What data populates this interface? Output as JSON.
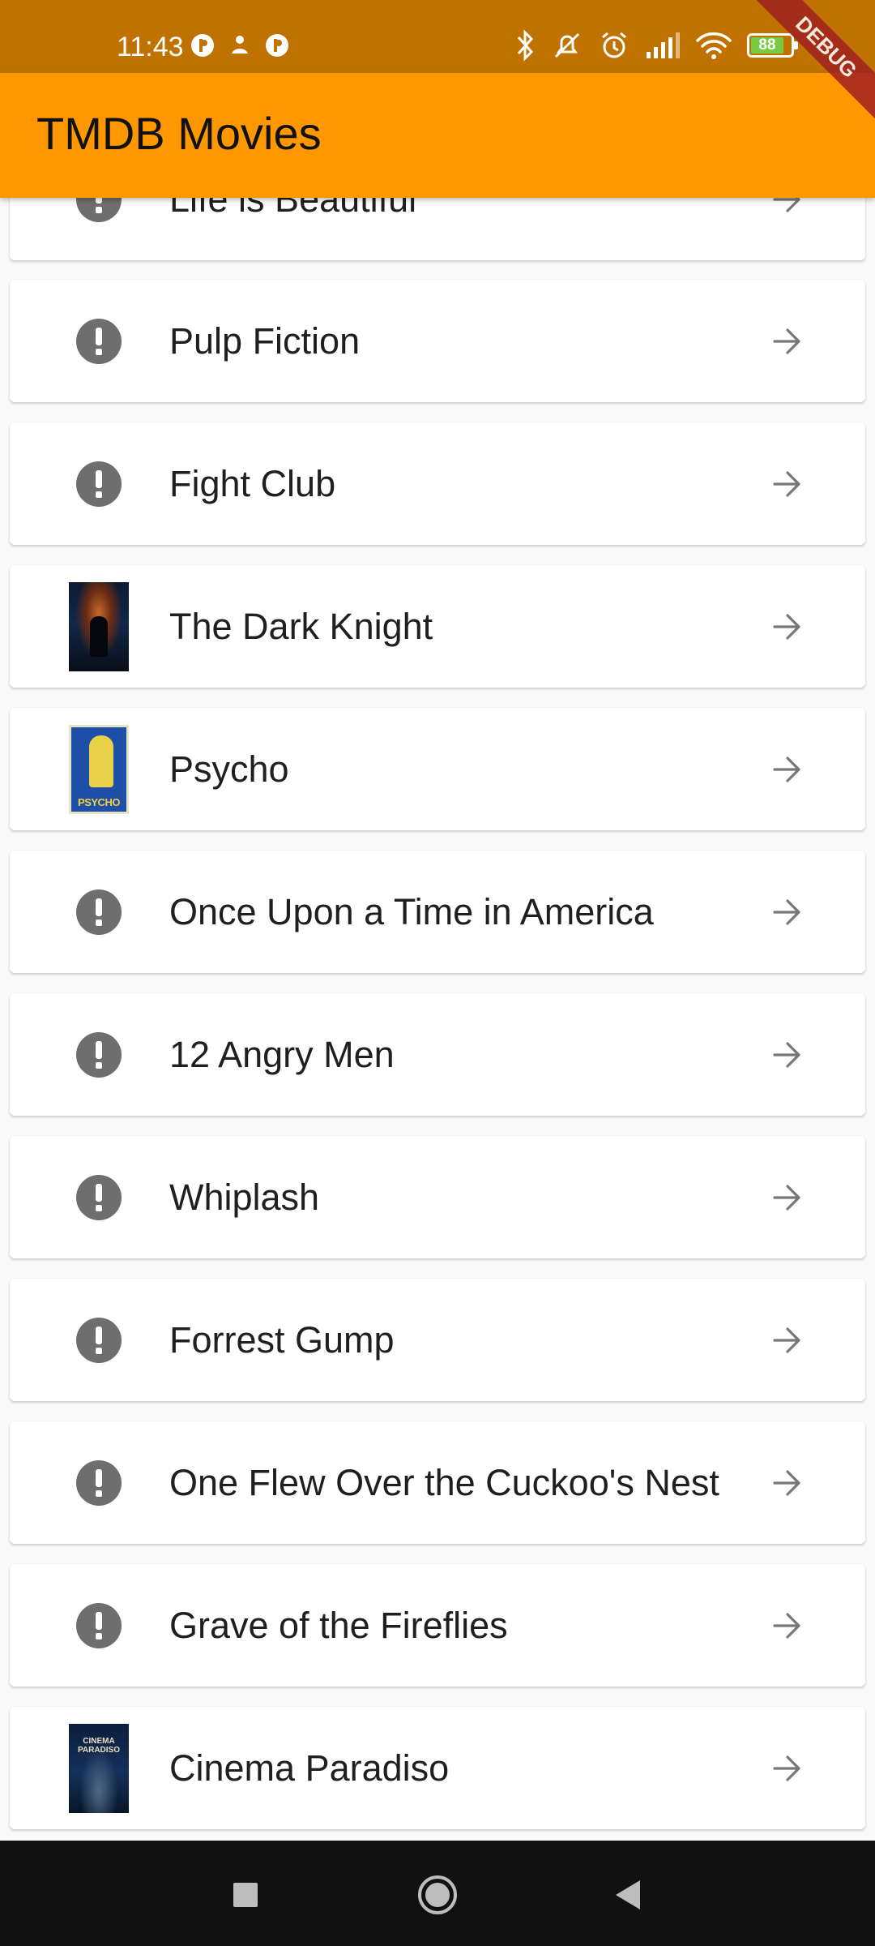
{
  "status_bar": {
    "time": "11:43",
    "battery_level": "88",
    "icons_left": [
      "p-badge-icon",
      "fan-icon",
      "p-badge-icon"
    ],
    "icons_right": [
      "bluetooth-icon",
      "mute-icon",
      "alarm-icon",
      "signal-icon",
      "wifi-icon",
      "battery-icon"
    ]
  },
  "app_bar": {
    "title": "TMDB Movies",
    "color": "#ff9800"
  },
  "debug_banner": "DEBUG",
  "movies": [
    {
      "title": "Life is Beautiful",
      "poster": "alert"
    },
    {
      "title": "Pulp Fiction",
      "poster": "alert"
    },
    {
      "title": "Fight Club",
      "poster": "alert"
    },
    {
      "title": "The Dark Knight",
      "poster": "image"
    },
    {
      "title": "Psycho",
      "poster": "image"
    },
    {
      "title": "Once Upon a Time in America",
      "poster": "alert"
    },
    {
      "title": "12 Angry Men",
      "poster": "alert"
    },
    {
      "title": "Whiplash",
      "poster": "alert"
    },
    {
      "title": "Forrest Gump",
      "poster": "alert"
    },
    {
      "title": "One Flew Over the Cuckoo's Nest",
      "poster": "alert"
    },
    {
      "title": "Grave of the Fireflies",
      "poster": "alert"
    },
    {
      "title": "Cinema Paradiso",
      "poster": "image"
    }
  ],
  "nav_bar": {
    "buttons": [
      "recents-square-icon",
      "home-circle-icon",
      "back-triangle-icon"
    ]
  }
}
